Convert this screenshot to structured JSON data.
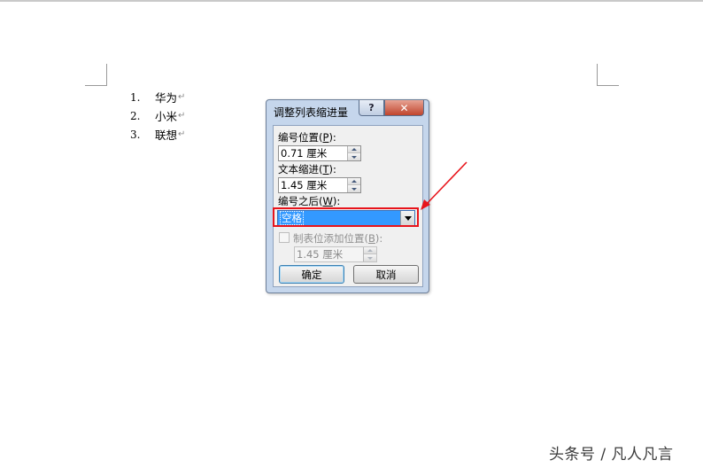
{
  "document": {
    "list": [
      {
        "number": "1.",
        "text": "华为"
      },
      {
        "number": "2.",
        "text": "小米"
      },
      {
        "number": "3.",
        "text": "联想"
      }
    ],
    "paragraph_mark": "↵"
  },
  "dialog": {
    "title": "调整列表缩进量",
    "help_label": "?",
    "close_label": "✕",
    "number_position": {
      "label": "编号位置",
      "hotkey": "P",
      "value": "0.71 厘米"
    },
    "text_indent": {
      "label": "文本缩进",
      "hotkey": "T",
      "value": "1.45 厘米"
    },
    "follow_number": {
      "label": "编号之后",
      "hotkey": "W",
      "selected": "空格"
    },
    "add_tab_stop": {
      "label": "制表位添加位置",
      "hotkey": "B",
      "checked": false,
      "value": "1.45 厘米"
    },
    "ok_label": "确定",
    "cancel_label": "取消"
  },
  "annotation": {
    "color": "#e8141b"
  },
  "watermark": "头条号 / 凡人凡言"
}
